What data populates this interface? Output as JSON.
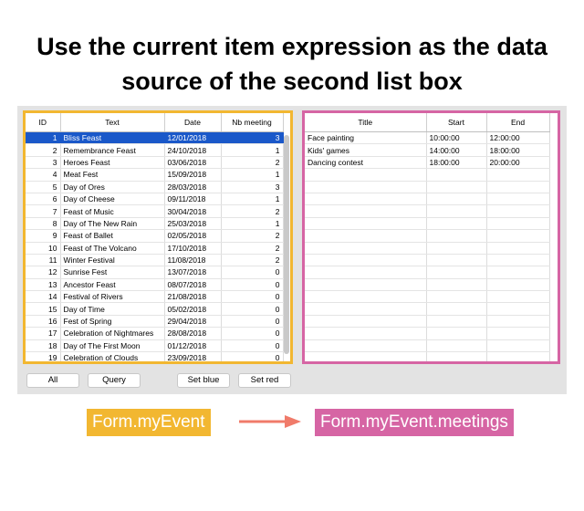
{
  "headline": {
    "line1": "Use the current item expression as the data",
    "line2": "source of the second list box"
  },
  "events_list": {
    "headers": [
      "ID",
      "Text",
      "Date",
      "Nb meeting"
    ],
    "rows": [
      [
        "1",
        "Bliss Feast",
        "12/01/2018",
        "3"
      ],
      [
        "2",
        "Remembrance Feast",
        "24/10/2018",
        "1"
      ],
      [
        "3",
        "Heroes Feast",
        "03/06/2018",
        "2"
      ],
      [
        "4",
        "Meat Fest",
        "15/09/2018",
        "1"
      ],
      [
        "5",
        "Day of Ores",
        "28/03/2018",
        "3"
      ],
      [
        "6",
        "Day of Cheese",
        "09/11/2018",
        "1"
      ],
      [
        "7",
        "Feast of Music",
        "30/04/2018",
        "2"
      ],
      [
        "8",
        "Day of The New Rain",
        "25/03/2018",
        "1"
      ],
      [
        "9",
        "Feast of Ballet",
        "02/05/2018",
        "2"
      ],
      [
        "10",
        "Feast of The Volcano",
        "17/10/2018",
        "2"
      ],
      [
        "11",
        "Winter Festival",
        "11/08/2018",
        "2"
      ],
      [
        "12",
        "Sunrise Fest",
        "13/07/2018",
        "0"
      ],
      [
        "13",
        "Ancestor Feast",
        "08/07/2018",
        "0"
      ],
      [
        "14",
        "Festival of Rivers",
        "21/08/2018",
        "0"
      ],
      [
        "15",
        "Day of Time",
        "05/02/2018",
        "0"
      ],
      [
        "16",
        "Fest of Spring",
        "29/04/2018",
        "0"
      ],
      [
        "17",
        "Celebration of Nightmares",
        "28/08/2018",
        "0"
      ],
      [
        "18",
        "Day of The First Moon",
        "01/12/2018",
        "0"
      ],
      [
        "19",
        "Celebration of Clouds",
        "23/09/2018",
        "0"
      ]
    ],
    "selected_row": 0
  },
  "meetings_list": {
    "headers": [
      "Title",
      "Start",
      "End"
    ],
    "rows": [
      [
        "Face painting",
        "10:00:00",
        "12:00:00"
      ],
      [
        "Kids' games",
        "14:00:00",
        "18:00:00"
      ],
      [
        "Dancing contest",
        "18:00:00",
        "20:00:00"
      ]
    ],
    "empty_rows": 17
  },
  "buttons": {
    "all": "All",
    "query": "Query",
    "set_blue": "Set blue",
    "set_red": "Set red"
  },
  "labels": {
    "current_item": "Form.myEvent",
    "data_source": "Form.myEvent.meetings"
  },
  "colors": {
    "left_border": "#f2b731",
    "right_border": "#d665a4",
    "selection": "#1a58c9",
    "arrow": "#f07b6a"
  }
}
